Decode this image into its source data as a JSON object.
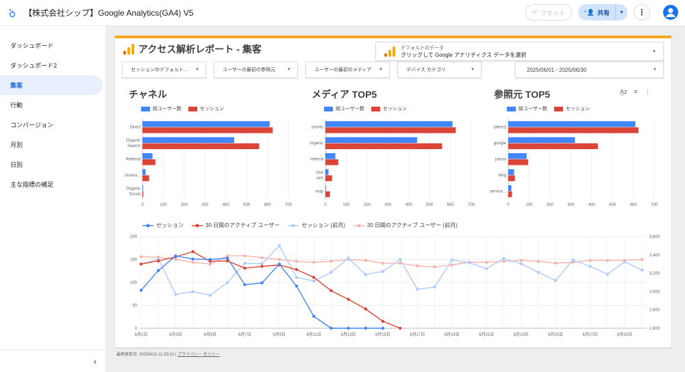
{
  "app": {
    "title": "【株式会社シップ】Google Analytics(GA4) V5",
    "reset_label": "リセット",
    "share_label": "共有"
  },
  "sidebar": {
    "items": [
      {
        "label": "ダッシュボード"
      },
      {
        "label": "ダッシュボード2"
      },
      {
        "label": "集客"
      },
      {
        "label": "行動"
      },
      {
        "label": "コンバージョン"
      },
      {
        "label": "月別"
      },
      {
        "label": "日別"
      },
      {
        "label": "主な指標の補足"
      }
    ],
    "active_index": 2
  },
  "report": {
    "title": "アクセス解析レポート - 集客",
    "data_source": {
      "label": "デフォルトのデータ",
      "value": "クリックして Google アナリティクス データを選択"
    },
    "filters": [
      "セッションのデフォルト...",
      "ユーザーの最初の参照元",
      "ユーザーの最初のメディア",
      "デバイス カテゴリ"
    ],
    "date_range": "2025/06/01 - 2025/06/30"
  },
  "colors": {
    "blue": "#4285f4",
    "red": "#db4437",
    "light_blue": "#aecbfa",
    "light_red": "#f4b4ae",
    "accent": "#f9a825"
  },
  "chart_data": [
    {
      "type": "bar",
      "title": "チャネル",
      "orientation": "horizontal",
      "categories": [
        "Direct",
        "Organic Search",
        "Referral",
        "Unassi...",
        "Organic Social"
      ],
      "series": [
        {
          "name": "総ユーザー数",
          "values": [
            610,
            440,
            48,
            15,
            3
          ]
        },
        {
          "name": "セッション",
          "values": [
            625,
            560,
            62,
            32,
            4
          ]
        }
      ],
      "xlim": [
        0,
        700
      ],
      "xticks": [
        0,
        100,
        200,
        300,
        400,
        500,
        600,
        700
      ]
    },
    {
      "type": "bar",
      "title": "メディア TOP5",
      "orientation": "horizontal",
      "categories": [
        "(none)",
        "organic",
        "referral",
        "(not set)",
        "map"
      ],
      "series": [
        {
          "name": "総ユーザー数",
          "values": [
            610,
            440,
            48,
            15,
            3
          ]
        },
        {
          "name": "セッション",
          "values": [
            625,
            560,
            62,
            32,
            22
          ]
        }
      ],
      "xlim": [
        0,
        700
      ],
      "xticks": [
        0,
        100,
        200,
        300,
        400,
        500,
        600,
        700
      ]
    },
    {
      "type": "bar",
      "title": "参照元 TOP5",
      "orientation": "horizontal",
      "categories": [
        "(direct)",
        "google",
        "yahoo",
        "bing",
        "service..."
      ],
      "series": [
        {
          "name": "総ユーザー数",
          "values": [
            610,
            320,
            88,
            28,
            15
          ]
        },
        {
          "name": "セッション",
          "values": [
            625,
            430,
            95,
            32,
            18
          ]
        }
      ],
      "xlim": [
        0,
        700
      ],
      "xticks": [
        0,
        100,
        200,
        300,
        400,
        500,
        600,
        700
      ]
    },
    {
      "type": "line",
      "x": [
        "6月1日",
        "6月2日",
        "6月3日",
        "6月4日",
        "6月5日",
        "6月6日",
        "6月7日",
        "6月8日",
        "6月9日",
        "6月10日",
        "6月11日",
        "6月12日",
        "6月13日",
        "6月14日",
        "6月15日",
        "6月16日",
        "6月17日",
        "6月18日",
        "6月19日",
        "6月20日",
        "6月21日",
        "6月22日",
        "6月23日",
        "6月24日",
        "6月25日",
        "6月26日",
        "6月27日",
        "6月28日",
        "6月29日",
        "6月30日"
      ],
      "xtick_labels": [
        "6月1日",
        "6月3日",
        "6月5日",
        "6月7日",
        "6月9日",
        "6月11日",
        "6月13日",
        "6月15日",
        "6月17日",
        "6月19日",
        "6月21日",
        "6月23日",
        "6月25日",
        "6月27日",
        "6月29日"
      ],
      "series": [
        {
          "name": "セッション",
          "axis": "left",
          "values": [
            83,
            126,
            158,
            151,
            150,
            153,
            95,
            99,
            140,
            92,
            26,
            0,
            0,
            0,
            0,
            null,
            null,
            null,
            null,
            null,
            null,
            null,
            null,
            null,
            null,
            null,
            null,
            null,
            null,
            null
          ]
        },
        {
          "name": "30 日間のアクティブ ユーザー",
          "axis": "left",
          "values": [
            140,
            147,
            156,
            167,
            146,
            147,
            131,
            135,
            138,
            128,
            111,
            82,
            63,
            42,
            15,
            0,
            null,
            null,
            null,
            null,
            null,
            null,
            null,
            null,
            null,
            null,
            null,
            null,
            null,
            null
          ]
        },
        {
          "name": "セッション (前月)",
          "axis": "left",
          "values": [
            140,
            151,
            74,
            80,
            72,
            100,
            142,
            141,
            180,
            111,
            103,
            122,
            153,
            117,
            124,
            150,
            85,
            90,
            149,
            143,
            130,
            152,
            141,
            122,
            104,
            149,
            135,
            118,
            145,
            127
          ]
        },
        {
          "name": "30 日間のアクティブ ユーザー (前月)",
          "axis": "right",
          "values": [
            3380,
            3375,
            3350,
            3320,
            3300,
            3390,
            3390,
            3370,
            3350,
            3330,
            3320,
            3330,
            3350,
            3340,
            3310,
            3310,
            3280,
            3270,
            3290,
            3320,
            3320,
            3330,
            3340,
            3330,
            3310,
            3320,
            3340,
            3340,
            3340,
            3350
          ]
        }
      ],
      "ylim_left": [
        0,
        200
      ],
      "yticks_left": [
        0,
        50,
        100,
        150,
        200
      ],
      "ylim_right": [
        2600,
        3600
      ],
      "yticks_right": [
        "2,600",
        "2,800",
        "3,000",
        "3,200",
        "3,400",
        "3,600"
      ]
    }
  ],
  "footer": {
    "updated": "最終更新日: 2025/6/11 11:35:02",
    "privacy": "プライバシー ポリシー"
  }
}
